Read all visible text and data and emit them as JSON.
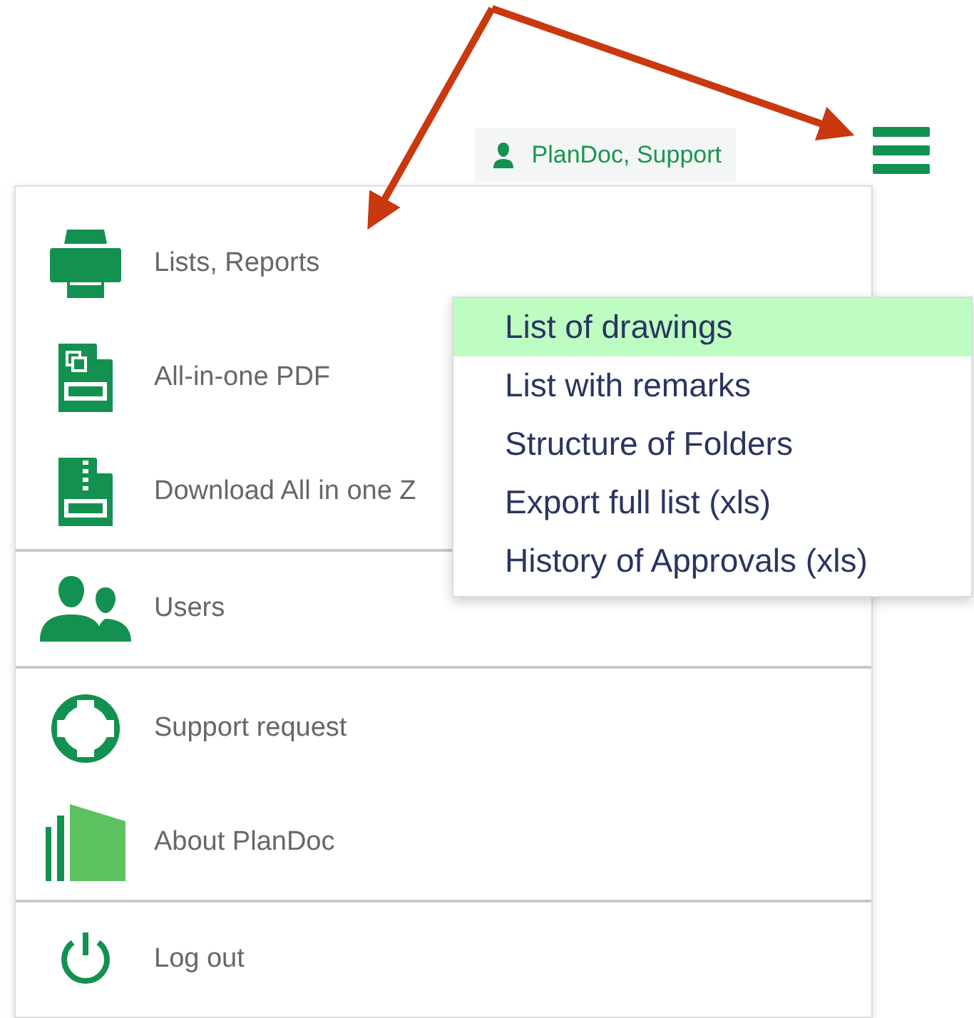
{
  "user_badge": {
    "label": "PlanDoc, Support"
  },
  "menu": {
    "groups": [
      {
        "items": [
          {
            "label": "Lists, Reports"
          },
          {
            "label": "All-in-one PDF"
          },
          {
            "label": "Download All in one Z"
          }
        ]
      },
      {
        "items": [
          {
            "label": "Users"
          }
        ]
      },
      {
        "items": [
          {
            "label": "Support request"
          },
          {
            "label": "About PlanDoc"
          }
        ]
      },
      {
        "items": [
          {
            "label": "Log out"
          }
        ]
      }
    ]
  },
  "submenu": {
    "items": [
      {
        "label": "List of drawings",
        "selected": true
      },
      {
        "label": "List with remarks",
        "selected": false
      },
      {
        "label": "Structure of Folders",
        "selected": false
      },
      {
        "label": "Export full list (xls)",
        "selected": false
      },
      {
        "label": "History of Approvals (xls)",
        "selected": false
      }
    ]
  }
}
